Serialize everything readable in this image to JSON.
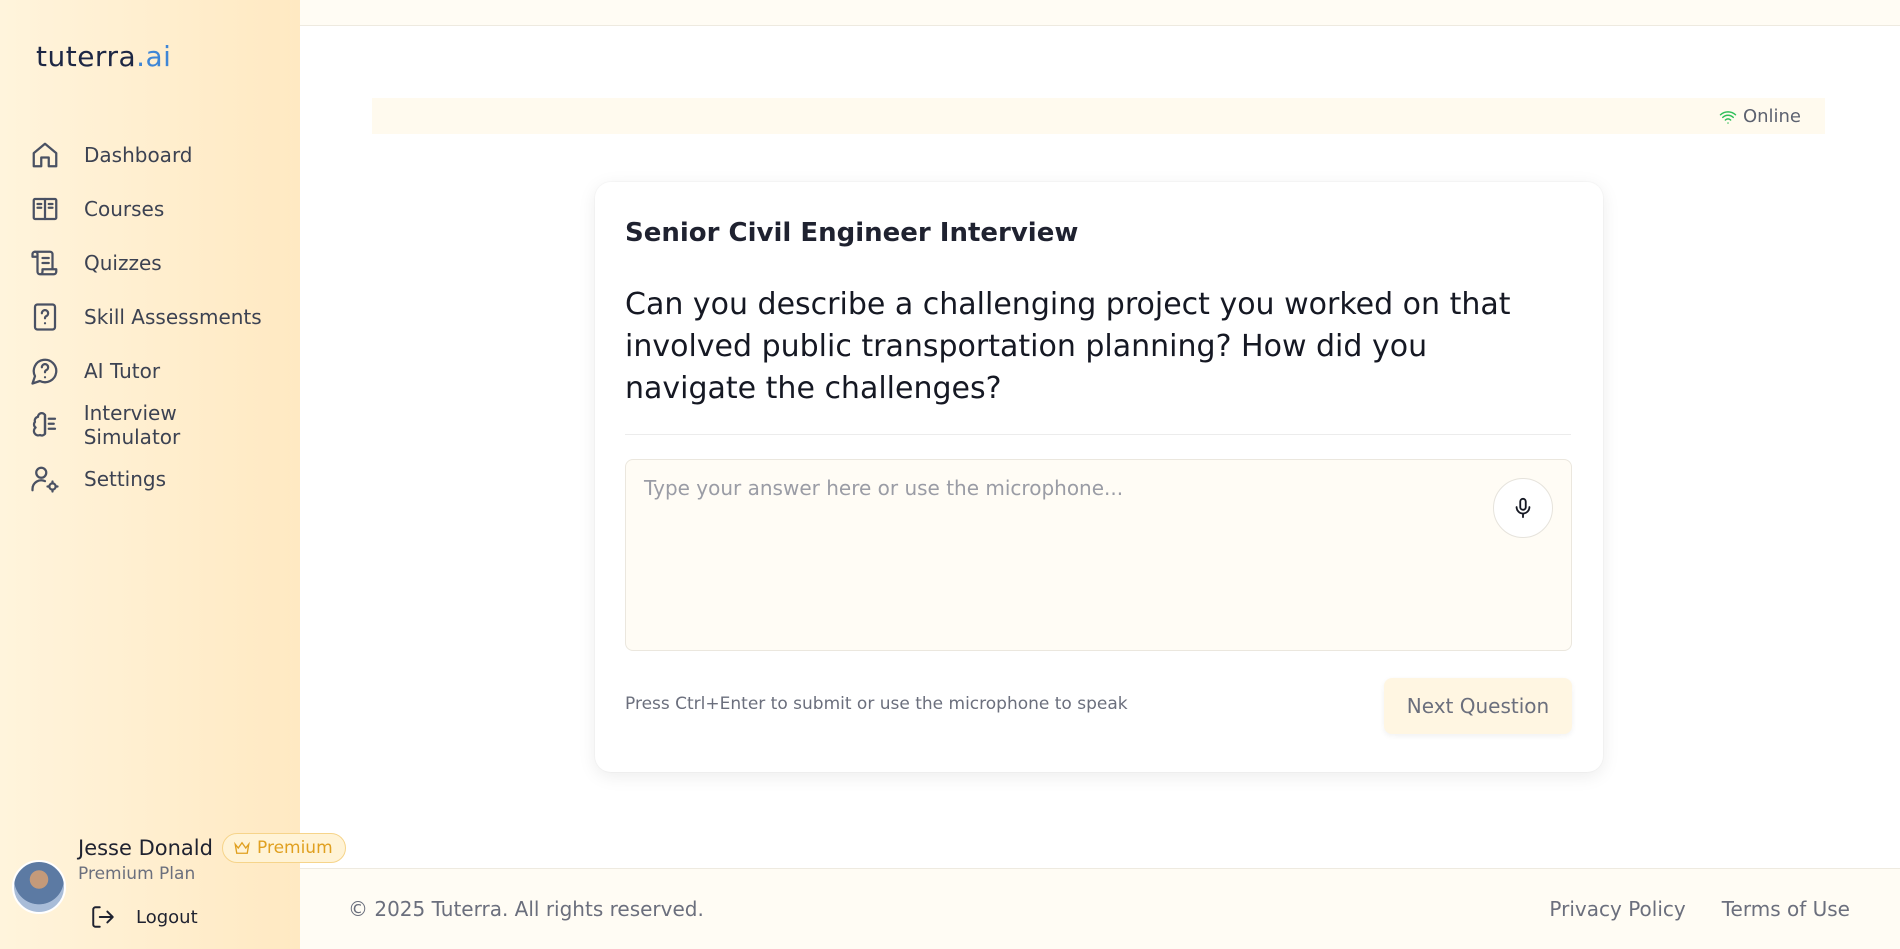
{
  "brand": {
    "prefix": "tut",
    "middle": "erra",
    "suffix": ".ai"
  },
  "sidebar": {
    "items": [
      {
        "label": "Dashboard",
        "icon": "home-icon"
      },
      {
        "label": "Courses",
        "icon": "book-open-icon"
      },
      {
        "label": "Quizzes",
        "icon": "scroll-icon"
      },
      {
        "label": "Skill Assessments",
        "icon": "file-question-icon"
      },
      {
        "label": "AI Tutor",
        "icon": "message-question-icon"
      },
      {
        "label": "Interview Simulator",
        "icon": "brain-icon"
      },
      {
        "label": "Settings",
        "icon": "user-cog-icon"
      }
    ]
  },
  "user": {
    "name": "Jesse Donald",
    "badge": "Premium",
    "plan": "Premium Plan",
    "logout_label": "Logout"
  },
  "status": {
    "label": "Online",
    "color": "#2fbf5a"
  },
  "interview": {
    "title": "Senior Civil Engineer Interview",
    "question": "Can you describe a challenging project you worked on that involved public transportation planning? How did you navigate the challenges?",
    "answer_value": "",
    "answer_placeholder": "Type your answer here or use the microphone...",
    "hint": "Press Ctrl+Enter to submit or use the microphone to speak",
    "next_label": "Next Question"
  },
  "footer": {
    "copyright": "© 2025 Tuterra. All rights reserved.",
    "links": [
      "Privacy Policy",
      "Terms of Use"
    ]
  },
  "colors": {
    "accent": "#3f86d6",
    "premium": "#e0a020",
    "sidebar_bg": "#ffe9c2"
  }
}
